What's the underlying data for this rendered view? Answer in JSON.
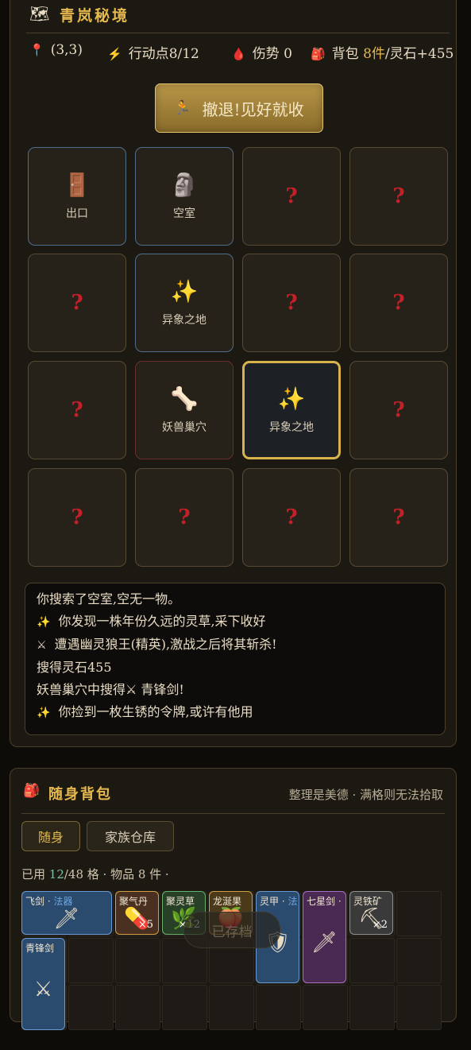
{
  "explore": {
    "title": "青岚秘境",
    "title_icon": "map-icon",
    "stats": {
      "position": "(3,3)",
      "action_label": "行动点",
      "action_value": "8/12",
      "injury_label": "伤势",
      "injury_value": "0",
      "bag_label": "背包",
      "bag_items": "8件",
      "spirit_stone": "/灵石+455"
    },
    "retreat_button": "撤退!见好就收",
    "cells": [
      {
        "label": "出口",
        "icon": "🚪",
        "kind": "blue"
      },
      {
        "label": "空室",
        "icon": "🗿",
        "kind": "blue"
      },
      {
        "label": "",
        "icon": "?",
        "kind": "unknown"
      },
      {
        "label": "",
        "icon": "?",
        "kind": "unknown"
      },
      {
        "label": "",
        "icon": "?",
        "kind": "unknown"
      },
      {
        "label": "异象之地",
        "icon": "✨",
        "kind": "blue"
      },
      {
        "label": "",
        "icon": "?",
        "kind": "unknown"
      },
      {
        "label": "",
        "icon": "?",
        "kind": "unknown"
      },
      {
        "label": "",
        "icon": "?",
        "kind": "unknown"
      },
      {
        "label": "妖兽巢穴",
        "icon": "🦴",
        "kind": "red"
      },
      {
        "label": "异象之地",
        "icon": "✨",
        "kind": "selected"
      },
      {
        "label": "",
        "icon": "?",
        "kind": "unknown"
      },
      {
        "label": "",
        "icon": "?",
        "kind": "unknown"
      },
      {
        "label": "",
        "icon": "?",
        "kind": "unknown"
      },
      {
        "label": "",
        "icon": "?",
        "kind": "unknown"
      },
      {
        "label": "",
        "icon": "?",
        "kind": "unknown"
      }
    ],
    "log": [
      {
        "icon": "",
        "text": "你搜索了空室,空无一物。"
      },
      {
        "icon": "✨",
        "text": "你发现一株年份久远的灵草,采下收好"
      },
      {
        "icon": "⚔",
        "text": "遭遇幽灵狼王(精英),激战之后将其斩杀!"
      },
      {
        "icon": "",
        "text": "搜得灵石455"
      },
      {
        "icon": "",
        "text": "妖兽巢穴中搜得⚔ 青锋剑!"
      },
      {
        "icon": "✨",
        "text": "你捡到一枚生锈的令牌,或许有他用"
      }
    ]
  },
  "bag": {
    "title": "随身背包",
    "hint": "整理是美德 · 满格则无法拾取",
    "tabs": [
      "随身",
      "家族仓库"
    ],
    "usage_prefix": "已用 ",
    "usage_count": "12",
    "usage_suffix": "/48 格 · 物品 8 件 ·",
    "saved_label": "已存档",
    "items": [
      {
        "name": "飞剑 · ",
        "category": "法器",
        "art": "🗡",
        "qty": "",
        "bg": "#2a4a6e",
        "border": "#6a9ad0"
      },
      {
        "name": "聚气丹",
        "category": "",
        "art": "💊",
        "qty": "×5",
        "bg": "#4a3020",
        "border": "#d0a040"
      },
      {
        "name": "聚灵草",
        "category": "",
        "art": "🌿",
        "qty": "×12",
        "bg": "#284028",
        "border": "#6ab06a"
      },
      {
        "name": "龙涎果",
        "category": "",
        "art": "🍑",
        "qty": "",
        "bg": "#4a3a1a",
        "border": "#d0a040"
      },
      {
        "name": "灵甲 · ",
        "category": "法",
        "art": "🛡",
        "qty": "",
        "bg": "#2a4a6e",
        "border": "#6a9ad0"
      },
      {
        "name": "七星剑 · ",
        "category": "",
        "art": "🗡",
        "qty": "",
        "bg": "#4a2a52",
        "border": "#a870c0"
      },
      {
        "name": "灵铁矿",
        "category": "",
        "art": "⛏",
        "qty": "×2",
        "bg": "#3a3a3a",
        "border": "#909090"
      },
      {
        "name": "青锋剑",
        "category": "",
        "art": "⚔",
        "qty": "",
        "bg": "#2a4a6e",
        "border": "#6a9ad0"
      }
    ]
  }
}
